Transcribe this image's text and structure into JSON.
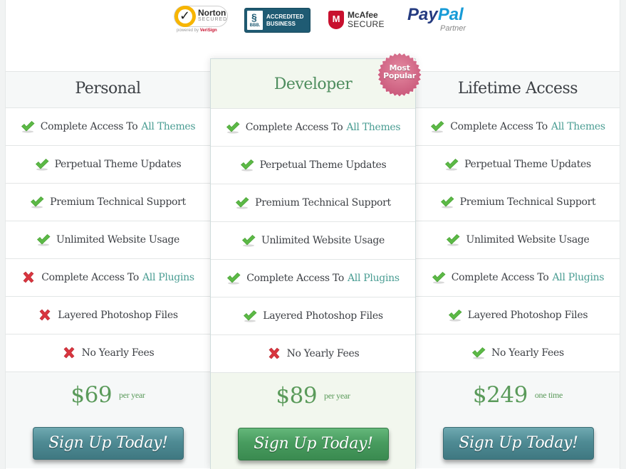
{
  "trust_badges": {
    "norton": {
      "title": "Norton",
      "subtitle": "SECURED",
      "powered_prefix": "powered by",
      "powered_brand": "VeriSign"
    },
    "bbb": {
      "logo_text": "BBB.",
      "line1": "ACCREDITED",
      "line2": "BUSINESS"
    },
    "mcafee": {
      "line1": "McAfee",
      "line2": "SECURE"
    },
    "paypal": {
      "pay": "Pay",
      "pal": "Pal",
      "subtitle": "Partner"
    }
  },
  "ribbon": {
    "line1": "Most",
    "line2": "Popular"
  },
  "colors": {
    "link": "#4a9d93",
    "price": "#5a9a5a",
    "check": "#5cb946",
    "cross": "#d9353f",
    "teal_button": "#4f8b94",
    "green_button": "#489c5f",
    "ribbon": "#d1627f"
  },
  "plans": [
    {
      "name": "Personal",
      "features": [
        {
          "included": true,
          "text": "Complete Access To",
          "link": "All Themes"
        },
        {
          "included": true,
          "text": "Perpetual Theme Updates",
          "link": ""
        },
        {
          "included": true,
          "text": "Premium Technical Support",
          "link": ""
        },
        {
          "included": true,
          "text": "Unlimited Website Usage",
          "link": ""
        },
        {
          "included": false,
          "text": "Complete Access To",
          "link": "All Plugins"
        },
        {
          "included": false,
          "text": "Layered Photoshop Files",
          "link": ""
        },
        {
          "included": false,
          "text": "No Yearly Fees",
          "link": ""
        }
      ],
      "price": "$69",
      "period": "per year",
      "button": "Sign Up Today!"
    },
    {
      "name": "Developer",
      "features": [
        {
          "included": true,
          "text": "Complete Access To",
          "link": "All Themes"
        },
        {
          "included": true,
          "text": "Perpetual Theme Updates",
          "link": ""
        },
        {
          "included": true,
          "text": "Premium Technical Support",
          "link": ""
        },
        {
          "included": true,
          "text": "Unlimited Website Usage",
          "link": ""
        },
        {
          "included": true,
          "text": "Complete Access To",
          "link": "All Plugins"
        },
        {
          "included": true,
          "text": "Layered Photoshop Files",
          "link": ""
        },
        {
          "included": false,
          "text": "No Yearly Fees",
          "link": ""
        }
      ],
      "price": "$89",
      "period": "per year",
      "button": "Sign Up Today!"
    },
    {
      "name": "Lifetime Access",
      "features": [
        {
          "included": true,
          "text": "Complete Access To",
          "link": "All Themes"
        },
        {
          "included": true,
          "text": "Perpetual Theme Updates",
          "link": ""
        },
        {
          "included": true,
          "text": "Premium Technical Support",
          "link": ""
        },
        {
          "included": true,
          "text": "Unlimited Website Usage",
          "link": ""
        },
        {
          "included": true,
          "text": "Complete Access To",
          "link": "All Plugins"
        },
        {
          "included": true,
          "text": "Layered Photoshop Files",
          "link": ""
        },
        {
          "included": true,
          "text": "No Yearly Fees",
          "link": ""
        }
      ],
      "price": "$249",
      "period": "one time",
      "button": "Sign Up Today!"
    }
  ]
}
